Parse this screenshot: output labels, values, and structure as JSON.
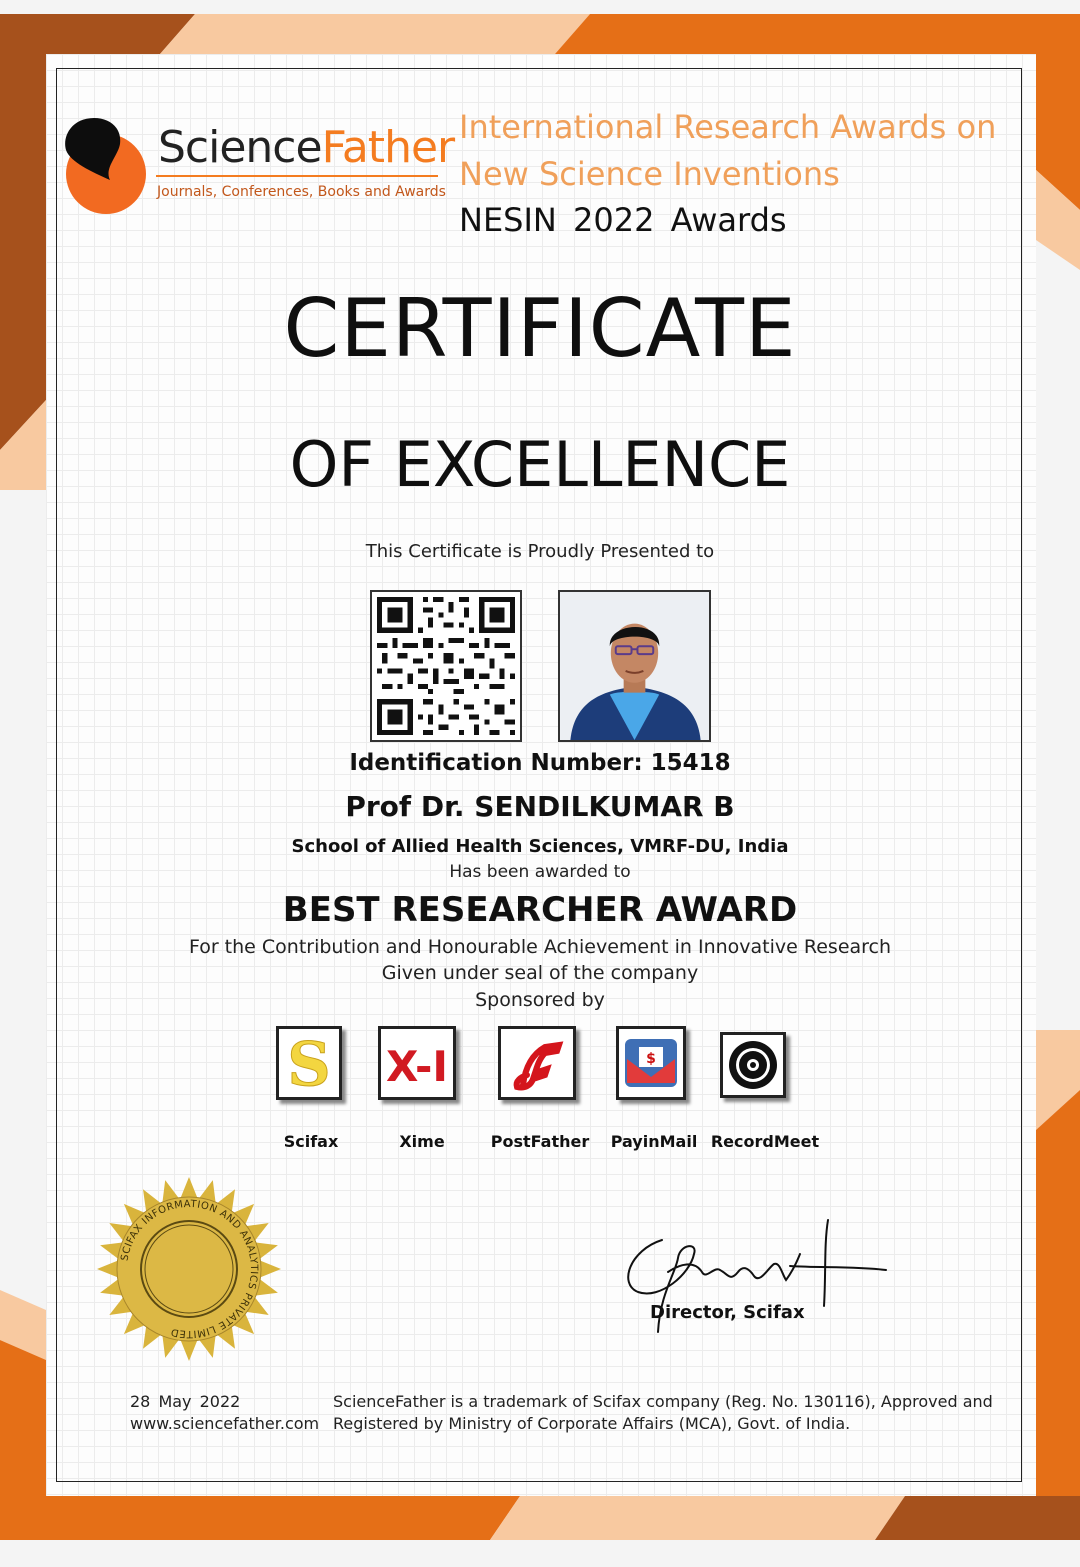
{
  "brand": {
    "name_part1": "Science",
    "name_part2": "Father",
    "tagline": "Journals, Conferences, Books and Awards"
  },
  "event": {
    "line1": "International Research Awards on",
    "line2": "New Science Inventions",
    "line3": "NESIN  2022  Awards"
  },
  "certificate": {
    "title": "CERTIFICATE",
    "subtitle": "OF EXCELLENCE",
    "presented_to": "This Certificate is Proudly Presented to",
    "identification": "Identification Number: 15418",
    "recipient_name": "Prof Dr. SENDILKUMAR B",
    "affiliation": "School of Allied Health Sciences, VMRF-DU, India",
    "awarded_to": "Has been awarded to",
    "award": "BEST RESEARCHER AWARD",
    "line1": "For the Contribution and Honourable Achievement in Innovative Research",
    "line2": "Given under seal of the company",
    "line3": "Sponsored by"
  },
  "sponsors": [
    {
      "label": "Scifax",
      "icon": "scifax-logo-icon"
    },
    {
      "label": "Xime",
      "icon": "xime-logo-icon"
    },
    {
      "label": "PostFather",
      "icon": "postfather-logo-icon"
    },
    {
      "label": "PayinMail",
      "icon": "payinmail-logo-icon"
    },
    {
      "label": "RecordMeet",
      "icon": "recordmeet-logo-icon"
    }
  ],
  "seal_text": "SCIFAX INFORMATION AND ANALYTICS PRIVATE LIMITED",
  "signature": {
    "title": "Director, Scifax"
  },
  "footer": {
    "date": "28  May  2022",
    "website": "www.sciencefather.com",
    "trademark_line1": "ScienceFather is a trademark of Scifax company (Reg. No. 130116), Approved and",
    "trademark_line2": "Registered by Ministry of Corporate Affairs (MCA), Govt. of India."
  },
  "colors": {
    "accent_orange": "#f47c20",
    "dark_orange": "#c8651b",
    "peach": "#f8c9a0",
    "brown": "#a6511c",
    "seal_gold": "#d9b43c"
  }
}
